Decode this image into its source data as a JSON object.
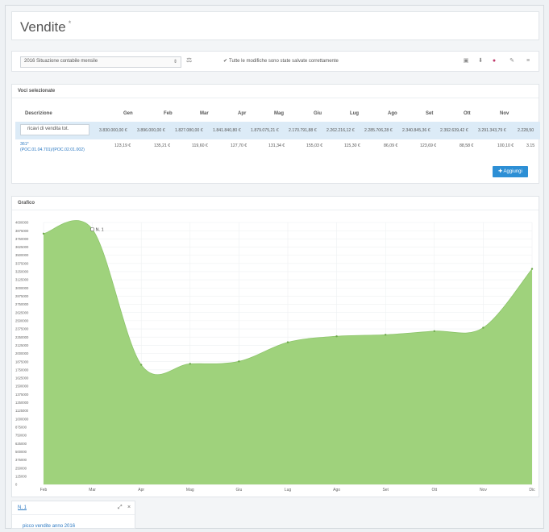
{
  "header": {
    "title": "Vendite",
    "title_mark": "*"
  },
  "toolbar": {
    "report_selected": "2016 Situazione contabile mensile",
    "save_status": "Tutte le modifiche sono state salvate correttamente",
    "icons": [
      "sync-icon",
      "save-icon",
      "download-icon",
      "lock-icon",
      "link-icon",
      "menu-icon"
    ]
  },
  "selected_items": {
    "title": "Voci selezionate",
    "columns": [
      "Descrizione",
      "Gen",
      "Feb",
      "Mar",
      "Apr",
      "Mag",
      "Giu",
      "Lug",
      "Ago",
      "Set",
      "Ott",
      "Nov"
    ],
    "rows": [
      {
        "description": "ricavi di vendita tot.",
        "values": [
          "3.830.000,00 €",
          "3.896.000,00 €",
          "1.827.080,00 €",
          "1.841.840,80 €",
          "1.879.075,21 €",
          "2.170.791,88 €",
          "2.262.216,12 €",
          "2.285.706,28 €",
          "2.340.845,36 €",
          "2.392.639,42 €",
          "3.291.343,79 €",
          "2.228,50"
        ]
      },
      {
        "description": "361*",
        "description_detail": "(POC.01.04.701)/(POC.02.01.002)",
        "values": [
          "123,19 €",
          "135,21 €",
          "119,60 €",
          "127,70 €",
          "131,34 €",
          "155,03 €",
          "115,30 €",
          "86,09 €",
          "123,69 €",
          "88,58 €",
          "100,10 €",
          "3.15"
        ]
      }
    ],
    "add_button": "Aggiungi"
  },
  "chart_panel": {
    "title": "Grafico"
  },
  "chart_data": {
    "type": "area",
    "x": [
      "Feb",
      "Mar",
      "Apr",
      "Mag",
      "Giu",
      "Lug",
      "Ago",
      "Set",
      "Ott",
      "Nov",
      "Dic"
    ],
    "values": [
      3830000,
      3896000,
      1827080,
      1841840,
      1879075,
      2170791,
      2262216,
      2285706,
      2340845,
      2392639,
      3291343
    ],
    "ylim": [
      0,
      4000000
    ],
    "yticks": [
      0,
      125000,
      250000,
      375000,
      500000,
      625000,
      750000,
      875000,
      1000000,
      1125000,
      1250000,
      1375000,
      1500000,
      1625000,
      1750000,
      1875000,
      2000000,
      2125000,
      2250000,
      2375000,
      2500000,
      2625000,
      2750000,
      2875000,
      3000000,
      3125000,
      3250000,
      3375000,
      3500000,
      3625000,
      3750000,
      3875000,
      4000000
    ],
    "annotation": {
      "label": "N. 1",
      "x": "Mar"
    },
    "fill_color": "#9fd27c",
    "grid": true
  },
  "annotations": {
    "title": "N. 1",
    "text": "picco vendite anno 2016"
  }
}
